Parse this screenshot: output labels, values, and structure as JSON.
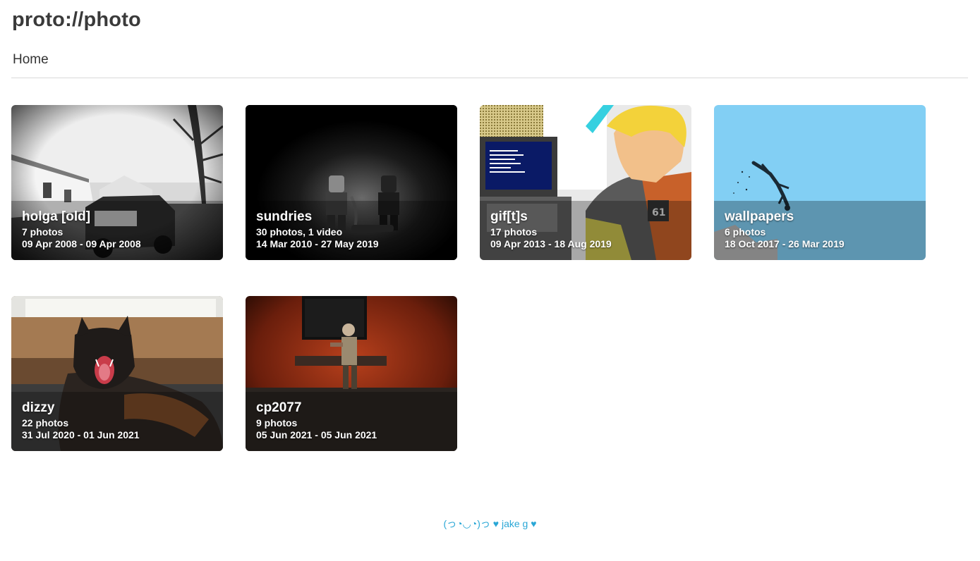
{
  "site": {
    "title": "proto://photo"
  },
  "nav": {
    "home": "Home"
  },
  "albums": [
    {
      "name": "holga [old]",
      "count": "7 photos",
      "dates": "09 Apr 2008 - 09 Apr 2008",
      "thumbnail": "black-and-white photo of a pickup truck parked by a house"
    },
    {
      "name": "sundries",
      "count": "30 photos, 1 video",
      "dates": "14 Mar 2010 - 27 May 2019",
      "thumbnail": "dark photo of two toy figures"
    },
    {
      "name": "gif[t]s",
      "count": "17 photos",
      "dates": "09 Apr 2013 - 18 Aug 2019",
      "thumbnail": "pixel-art illustration of a blond man at a computer"
    },
    {
      "name": "wallpapers",
      "count": "6 photos",
      "dates": "18 Oct 2017 - 26 Mar 2019",
      "thumbnail": "illustration of a figure falling against a blue sky"
    },
    {
      "name": "dizzy",
      "count": "22 photos",
      "dates": "31 Jul 2020 - 01 Jun 2021",
      "thumbnail": "photo of a yawning black cat by a window"
    },
    {
      "name": "cp2077",
      "count": "9 photos",
      "dates": "05 Jun 2021 - 05 Jun 2021",
      "thumbnail": "game screenshot of a character in a red elevator"
    }
  ],
  "footer": {
    "text": "(っ◔◡◔)っ ♥ jake g ♥"
  },
  "colors": {
    "title": "#3a3a3a",
    "footer_link": "#2aa7d6",
    "divider": "#d9d9d9"
  }
}
